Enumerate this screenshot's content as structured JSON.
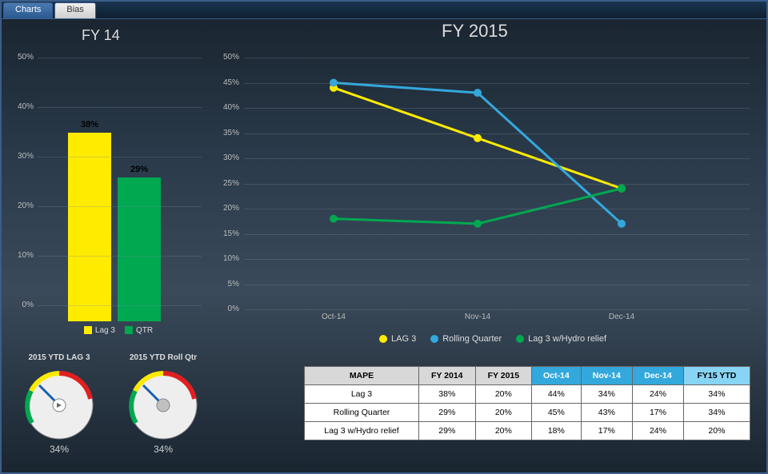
{
  "tabs": {
    "active": "Charts",
    "inactive": "Bias"
  },
  "chart_data": [
    {
      "type": "bar",
      "title": "FY 14",
      "categories": [
        "Lag 3",
        "QTR"
      ],
      "values": [
        38,
        29
      ],
      "ylabel": "",
      "ylim": [
        0,
        50
      ],
      "unit": "%",
      "colors": [
        "#ffeb00",
        "#00a850"
      ]
    },
    {
      "type": "line",
      "title": "FY 2015",
      "categories": [
        "Oct-14",
        "Nov-14",
        "Dec-14"
      ],
      "series": [
        {
          "name": "LAG 3",
          "values": [
            44,
            34,
            24
          ],
          "color": "#ffeb00"
        },
        {
          "name": "Rolling Quarter",
          "values": [
            45,
            43,
            17
          ],
          "color": "#33a8dd"
        },
        {
          "name": "Lag 3 w/Hydro relief",
          "values": [
            18,
            17,
            24
          ],
          "color": "#00a850"
        }
      ],
      "ylim": [
        0,
        50
      ],
      "unit": "%"
    }
  ],
  "gauges": [
    {
      "title": "2015 YTD LAG 3",
      "value": "34%"
    },
    {
      "title": "2015 YTD Roll Qtr",
      "value": "34%"
    }
  ],
  "table": {
    "header": [
      "MAPE",
      "FY 2014",
      "FY 2015",
      "Oct-14",
      "Nov-14",
      "Dec-14",
      "FY15 YTD"
    ],
    "header_blue_idx": [
      3,
      4,
      5
    ],
    "header_lightblue_idx": [
      6
    ],
    "rows": [
      [
        "Lag 3",
        "38%",
        "20%",
        "44%",
        "34%",
        "24%",
        "34%"
      ],
      [
        "Rolling Quarter",
        "29%",
        "20%",
        "45%",
        "43%",
        "17%",
        "34%"
      ],
      [
        "Lag 3 w/Hydro relief",
        "29%",
        "20%",
        "18%",
        "17%",
        "24%",
        "20%"
      ]
    ]
  },
  "bar_legend": [
    {
      "label": "Lag 3",
      "color": "#ffeb00"
    },
    {
      "label": "QTR",
      "color": "#00a850"
    }
  ]
}
